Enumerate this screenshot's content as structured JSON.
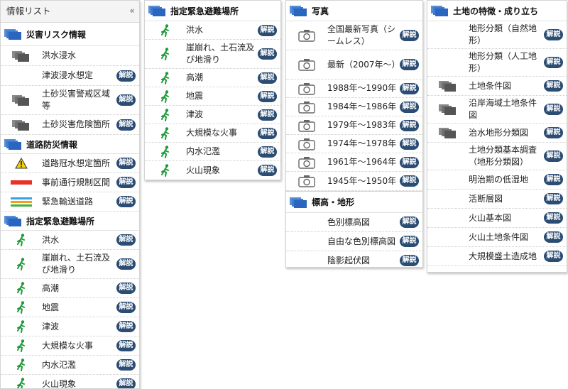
{
  "badge_label": "解説",
  "panel1": {
    "title": "情報リスト",
    "close": "«",
    "sec_risk": {
      "title": "災害リスク情報",
      "items": [
        "洪水浸水",
        "津波浸水想定",
        "土砂災害警戒区域等",
        "土砂災害危険箇所"
      ]
    },
    "sec_road": {
      "title": "道路防災情報",
      "items": [
        "道路冠水想定箇所",
        "事前通行規制区間",
        "緊急輸送道路"
      ]
    },
    "sec_evac": {
      "title": "指定緊急避難場所",
      "items": [
        "洪水",
        "崖崩れ、土石流及び地滑り",
        "高潮",
        "地震",
        "津波",
        "大規模な火事",
        "内水氾濫",
        "火山現象"
      ]
    }
  },
  "panel2": {
    "sec_evac": {
      "title": "指定緊急避難場所",
      "items": [
        "洪水",
        "崖崩れ、土石流及び地滑り",
        "高潮",
        "地震",
        "津波",
        "大規模な火事",
        "内水氾濫",
        "火山現象"
      ]
    }
  },
  "panel3": {
    "sec_photo": {
      "title": "写真",
      "items": [
        "全国最新写真（シームレス）",
        "最新（2007年～）",
        "1988年～1990年",
        "1984年～1986年",
        "1979年～1983年",
        "1974年～1978年",
        "1961年～1964年",
        "1945年～1950年"
      ]
    },
    "sec_elev": {
      "title": "標高・地形",
      "items": [
        "色別標高図",
        "自由な色別標高図",
        "陰影起伏図"
      ]
    }
  },
  "panel4": {
    "sec_land": {
      "title": "土地の特徴・成り立ち",
      "items": [
        "地形分類（自然地形）",
        "地形分類（人工地形）",
        "土地条件図",
        "沿岸海域土地条件図",
        "治水地形分類図",
        "土地分類基本調査（地形分類図）",
        "明治期の低湿地",
        "活断層図",
        "火山基本図",
        "火山土地条件図",
        "大規模盛土造成地"
      ]
    }
  },
  "colors": {
    "badge": "#2b4c73",
    "folder": "#3a75c8",
    "runner": "#1e9a3a",
    "road_closure": "#e8322a"
  }
}
